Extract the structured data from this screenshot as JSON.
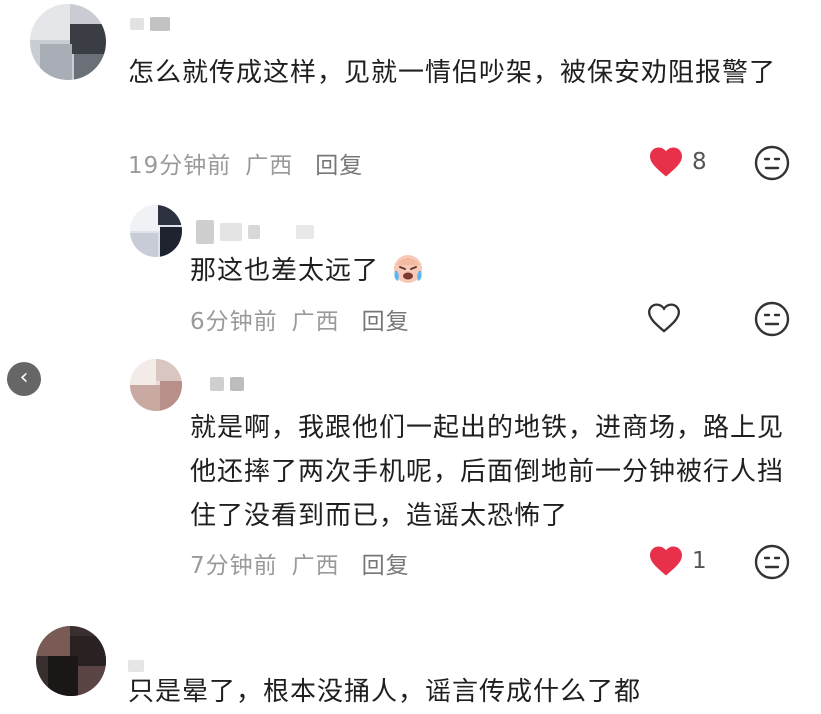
{
  "comments": [
    {
      "text": "怎么就传成这样，见就一情侣吵架，被保安劝阻报警了",
      "time": "19分钟前",
      "location": "广西",
      "reply_label": "回复",
      "likes": "8",
      "liked": true
    },
    {
      "text": "那这也差太远了",
      "emoji": "crying-laughing-face",
      "time": "6分钟前",
      "location": "广西",
      "reply_label": "回复",
      "liked": false
    },
    {
      "text": "就是啊，我跟他们一起出的地铁，进商场，路上见他还摔了两次手机呢，后面倒地前一分钟被行人挡住了没看到而已，造谣太恐怖了",
      "time": "7分钟前",
      "location": "广西",
      "reply_label": "回复",
      "likes": "1",
      "liked": true
    },
    {
      "text": "只是晕了，根本没捅人，谣言传成什么了都"
    }
  ],
  "colors": {
    "heart_active": "#e8304a",
    "meta_gray": "#9a9a9a"
  }
}
